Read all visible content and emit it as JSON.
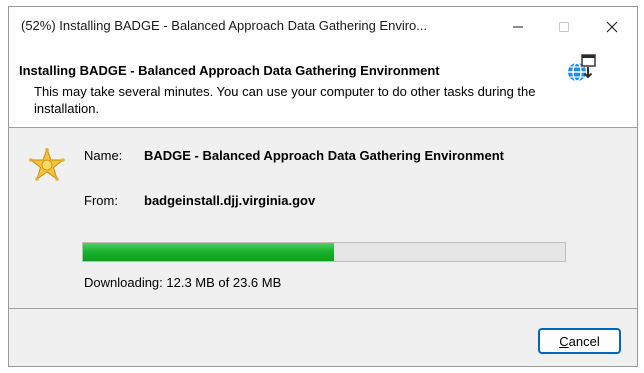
{
  "window": {
    "title": "(52%) Installing BADGE - Balanced Approach Data Gathering Enviro..."
  },
  "header": {
    "title": "Installing BADGE - Balanced Approach Data Gathering Environment",
    "description": "This may take several minutes. You can use your computer to do other tasks during the installation.",
    "icon": "globe-download-icon"
  },
  "details": {
    "app_icon": "sheriff-star-badge-icon",
    "name_label": "Name:",
    "name_value": "BADGE - Balanced Approach Data Gathering Environment",
    "from_label": "From:",
    "from_value": "badgeinstall.djj.virginia.gov"
  },
  "progress": {
    "fraction": 0.52,
    "status": "Downloading: 12.3 MB of 23.6 MB"
  },
  "buttons": {
    "cancel_access_key": "C",
    "cancel_rest": "ancel"
  },
  "colors": {
    "accent": "#0067c0",
    "progress_fill": "#17b02b",
    "panel_bg": "#f0f0f0"
  }
}
